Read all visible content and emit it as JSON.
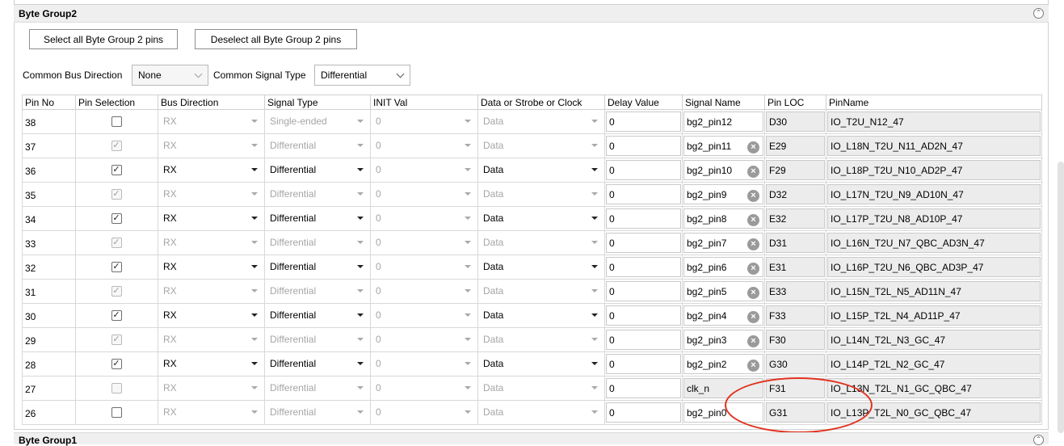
{
  "group": {
    "title": "Byte Group2",
    "select_all_label": "Select all Byte Group 2 pins",
    "deselect_all_label": "Deselect all Byte Group 2 pins",
    "common_bus_direction_label": "Common Bus Direction",
    "common_bus_direction_value": "None",
    "common_signal_type_label": "Common Signal Type",
    "common_signal_type_value": "Differential"
  },
  "table": {
    "headers": [
      "Pin No",
      "Pin Selection",
      "Bus Direction",
      "Signal Type",
      "INIT Val",
      "Data or Strobe or Clock",
      "Delay Value",
      "Signal Name",
      "Pin LOC",
      "PinName"
    ],
    "rows": [
      {
        "pin_no": "38",
        "checked": false,
        "enabled": true,
        "bus_direction": "RX",
        "signal_type": "Single-ended",
        "init_val": "0",
        "data_strobe": "Data",
        "delay": "0",
        "signal_name": "bg2_pin12",
        "clear": false,
        "pin_loc": "D30",
        "pin_name": "IO_T2U_N12_47",
        "active": false
      },
      {
        "pin_no": "37",
        "checked": true,
        "enabled": false,
        "bus_direction": "RX",
        "signal_type": "Differential",
        "init_val": "0",
        "data_strobe": "Data",
        "delay": "0",
        "signal_name": "bg2_pin11",
        "clear": true,
        "pin_loc": "E29",
        "pin_name": "IO_L18N_T2U_N11_AD2N_47",
        "active": false
      },
      {
        "pin_no": "36",
        "checked": true,
        "enabled": true,
        "bus_direction": "RX",
        "signal_type": "Differential",
        "init_val": "0",
        "data_strobe": "Data",
        "delay": "0",
        "signal_name": "bg2_pin10",
        "clear": true,
        "pin_loc": "F29",
        "pin_name": "IO_L18P_T2U_N10_AD2P_47",
        "active": true
      },
      {
        "pin_no": "35",
        "checked": true,
        "enabled": false,
        "bus_direction": "RX",
        "signal_type": "Differential",
        "init_val": "0",
        "data_strobe": "Data",
        "delay": "0",
        "signal_name": "bg2_pin9",
        "clear": true,
        "pin_loc": "D32",
        "pin_name": "IO_L17N_T2U_N9_AD10N_47",
        "active": false
      },
      {
        "pin_no": "34",
        "checked": true,
        "enabled": true,
        "bus_direction": "RX",
        "signal_type": "Differential",
        "init_val": "0",
        "data_strobe": "Data",
        "delay": "0",
        "signal_name": "bg2_pin8",
        "clear": true,
        "pin_loc": "E32",
        "pin_name": "IO_L17P_T2U_N8_AD10P_47",
        "active": true
      },
      {
        "pin_no": "33",
        "checked": true,
        "enabled": false,
        "bus_direction": "RX",
        "signal_type": "Differential",
        "init_val": "0",
        "data_strobe": "Data",
        "delay": "0",
        "signal_name": "bg2_pin7",
        "clear": true,
        "pin_loc": "D31",
        "pin_name": "IO_L16N_T2U_N7_QBC_AD3N_47",
        "active": false
      },
      {
        "pin_no": "32",
        "checked": true,
        "enabled": true,
        "bus_direction": "RX",
        "signal_type": "Differential",
        "init_val": "0",
        "data_strobe": "Data",
        "delay": "0",
        "signal_name": "bg2_pin6",
        "clear": true,
        "pin_loc": "E31",
        "pin_name": "IO_L16P_T2U_N6_QBC_AD3P_47",
        "active": true
      },
      {
        "pin_no": "31",
        "checked": true,
        "enabled": false,
        "bus_direction": "RX",
        "signal_type": "Differential",
        "init_val": "0",
        "data_strobe": "Data",
        "delay": "0",
        "signal_name": "bg2_pin5",
        "clear": true,
        "pin_loc": "E33",
        "pin_name": "IO_L15N_T2L_N5_AD11N_47",
        "active": false
      },
      {
        "pin_no": "30",
        "checked": true,
        "enabled": true,
        "bus_direction": "RX",
        "signal_type": "Differential",
        "init_val": "0",
        "data_strobe": "Data",
        "delay": "0",
        "signal_name": "bg2_pin4",
        "clear": true,
        "pin_loc": "F33",
        "pin_name": "IO_L15P_T2L_N4_AD11P_47",
        "active": true
      },
      {
        "pin_no": "29",
        "checked": true,
        "enabled": false,
        "bus_direction": "RX",
        "signal_type": "Differential",
        "init_val": "0",
        "data_strobe": "Data",
        "delay": "0",
        "signal_name": "bg2_pin3",
        "clear": true,
        "pin_loc": "F30",
        "pin_name": "IO_L14N_T2L_N3_GC_47",
        "active": false
      },
      {
        "pin_no": "28",
        "checked": true,
        "enabled": true,
        "bus_direction": "RX",
        "signal_type": "Differential",
        "init_val": "0",
        "data_strobe": "Data",
        "delay": "0",
        "signal_name": "bg2_pin2",
        "clear": true,
        "pin_loc": "G30",
        "pin_name": "IO_L14P_T2L_N2_GC_47",
        "active": true
      },
      {
        "pin_no": "27",
        "checked": false,
        "enabled": false,
        "bus_direction": "RX",
        "signal_type": "Differential",
        "init_val": "0",
        "data_strobe": "Data",
        "delay": "0",
        "signal_name": "clk_n",
        "clear": false,
        "pin_loc": "F31",
        "pin_name": "IO_L13N_T2L_N1_GC_QBC_47",
        "active": false
      },
      {
        "pin_no": "26",
        "checked": false,
        "enabled": true,
        "bus_direction": "RX",
        "signal_type": "Differential",
        "init_val": "0",
        "data_strobe": "Data",
        "delay": "0",
        "signal_name": "bg2_pin0",
        "clear": false,
        "pin_loc": "G31",
        "pin_name": "IO_L13P_T2L_N0_GC_QBC_47",
        "active": false
      }
    ]
  },
  "next_group": {
    "title": "Byte Group1"
  },
  "colors": {
    "annotation": "#e0301e",
    "disabled_text": "#a5a5a5"
  }
}
